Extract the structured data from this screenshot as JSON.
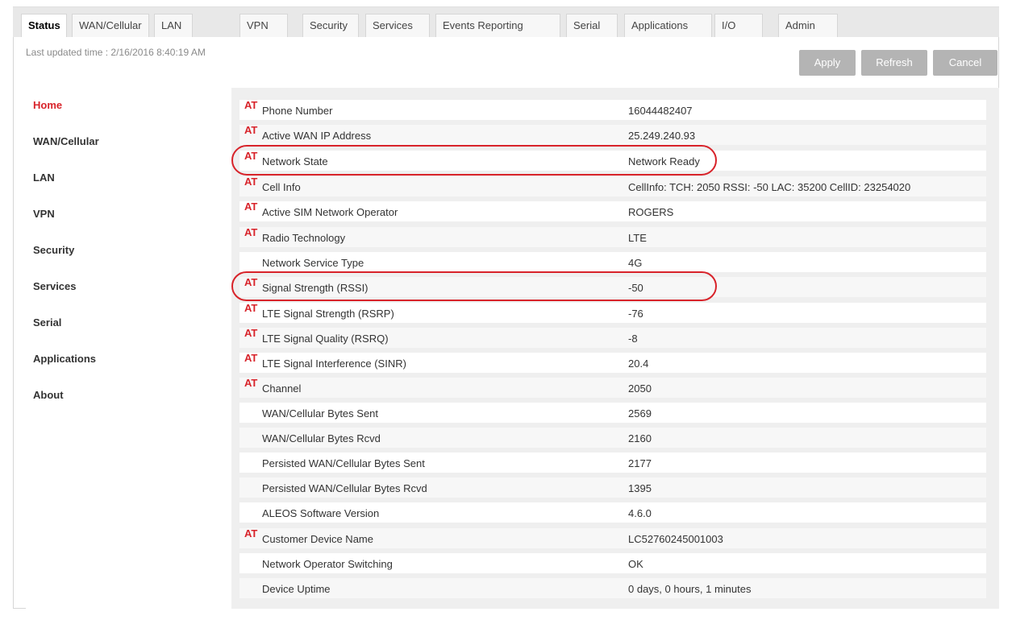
{
  "tabs": [
    {
      "label": "Status",
      "active": true
    },
    {
      "label": "WAN/Cellular"
    },
    {
      "label": "LAN"
    },
    {
      "label": "VPN"
    },
    {
      "label": "Security"
    },
    {
      "label": "Services"
    },
    {
      "label": "Events Reporting"
    },
    {
      "label": "Serial"
    },
    {
      "label": "Applications"
    },
    {
      "label": "I/O"
    },
    {
      "label": "Admin"
    }
  ],
  "header": {
    "last_updated": "Last updated time : 2/16/2016 8:40:19 AM",
    "apply_label": "Apply",
    "refresh_label": "Refresh",
    "cancel_label": "Cancel"
  },
  "sidebar": {
    "items": [
      {
        "label": "Home",
        "active": true
      },
      {
        "label": "WAN/Cellular"
      },
      {
        "label": "LAN"
      },
      {
        "label": "VPN"
      },
      {
        "label": "Security"
      },
      {
        "label": "Services"
      },
      {
        "label": "Serial"
      },
      {
        "label": "Applications"
      },
      {
        "label": "About"
      }
    ]
  },
  "at_marker": "AT",
  "status_rows": [
    {
      "at": true,
      "label": "Phone Number",
      "value": "16044482407"
    },
    {
      "at": true,
      "label": "Active WAN IP Address",
      "value": "25.249.240.93"
    },
    {
      "at": true,
      "label": "Network State",
      "value": "Network Ready",
      "highlighted": true
    },
    {
      "at": true,
      "label": "Cell Info",
      "value": "CellInfo: TCH: 2050 RSSI: -50 LAC: 35200 CellID: 23254020"
    },
    {
      "at": true,
      "label": "Active SIM Network Operator",
      "value": "ROGERS"
    },
    {
      "at": true,
      "label": "Radio Technology",
      "value": "LTE"
    },
    {
      "at": false,
      "label": "Network Service Type",
      "value": "4G"
    },
    {
      "at": true,
      "label": "Signal Strength (RSSI)",
      "value": "-50",
      "highlighted": true
    },
    {
      "at": true,
      "label": "LTE Signal Strength (RSRP)",
      "value": "-76"
    },
    {
      "at": true,
      "label": "LTE Signal Quality (RSRQ)",
      "value": "-8"
    },
    {
      "at": true,
      "label": "LTE Signal Interference (SINR)",
      "value": "20.4"
    },
    {
      "at": true,
      "label": "Channel",
      "value": "2050"
    },
    {
      "at": false,
      "label": "WAN/Cellular Bytes Sent",
      "value": "2569"
    },
    {
      "at": false,
      "label": "WAN/Cellular Bytes Rcvd",
      "value": "2160"
    },
    {
      "at": false,
      "label": "Persisted WAN/Cellular Bytes Sent",
      "value": "2177"
    },
    {
      "at": false,
      "label": "Persisted WAN/Cellular Bytes Rcvd",
      "value": "1395"
    },
    {
      "at": false,
      "label": "ALEOS Software Version",
      "value": "4.6.0"
    },
    {
      "at": true,
      "label": "Customer Device Name",
      "value": "LC52760245001003"
    },
    {
      "at": false,
      "label": "Network Operator Switching",
      "value": "OK"
    },
    {
      "at": false,
      "label": "Device Uptime",
      "value": "0 days, 0 hours, 1 minutes"
    }
  ],
  "colors": {
    "accent": "#d8232a",
    "button_gray": "#b4b4b4"
  }
}
